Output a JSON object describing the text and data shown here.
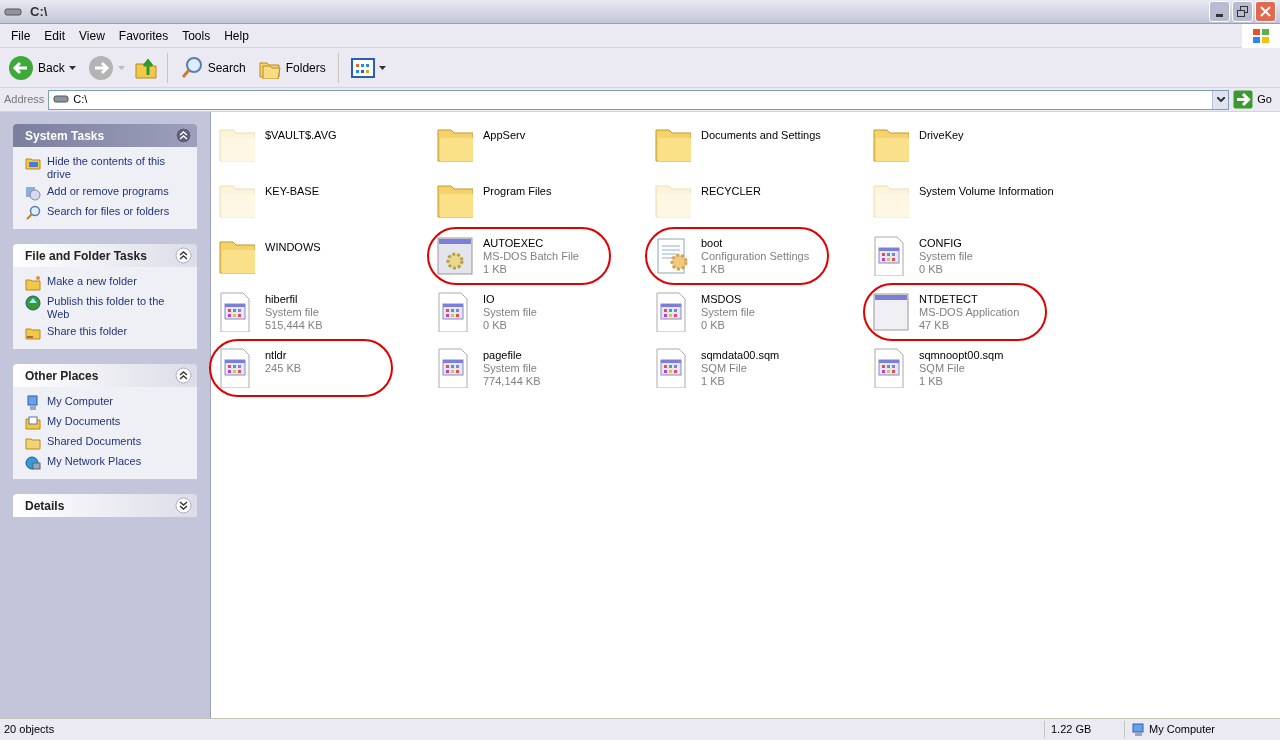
{
  "window": {
    "title": "C:\\"
  },
  "menu": [
    "File",
    "Edit",
    "View",
    "Favorites",
    "Tools",
    "Help"
  ],
  "toolbar": {
    "back": "Back",
    "search": "Search",
    "folders": "Folders"
  },
  "address": {
    "label": "Address",
    "value": "C:\\",
    "go": "Go"
  },
  "sidebar": [
    {
      "title": "System Tasks",
      "kind": "special",
      "expanded": true,
      "items": [
        {
          "label": "Hide the contents of this drive"
        },
        {
          "label": "Add or remove programs"
        },
        {
          "label": "Search for files or folders"
        }
      ]
    },
    {
      "title": "File and Folder Tasks",
      "kind": "normal",
      "expanded": true,
      "items": [
        {
          "label": "Make a new folder"
        },
        {
          "label": "Publish this folder to the Web"
        },
        {
          "label": "Share this folder"
        }
      ]
    },
    {
      "title": "Other Places",
      "kind": "normal",
      "expanded": true,
      "items": [
        {
          "label": "My Computer"
        },
        {
          "label": "My Documents"
        },
        {
          "label": "Shared Documents"
        },
        {
          "label": "My Network Places"
        }
      ]
    },
    {
      "title": "Details",
      "kind": "normal",
      "expanded": false
    }
  ],
  "files": [
    {
      "name": "$VAULT$.AVG",
      "kind": "folder",
      "hidden": true,
      "circled": false
    },
    {
      "name": "AppServ",
      "kind": "folder",
      "hidden": false,
      "circled": false
    },
    {
      "name": "Documents and Settings",
      "kind": "folder",
      "hidden": false,
      "circled": false
    },
    {
      "name": "DriveKey",
      "kind": "folder",
      "hidden": false,
      "circled": false
    },
    {
      "name": "KEY-BASE",
      "kind": "folder",
      "hidden": true,
      "circled": false
    },
    {
      "name": "Program Files",
      "kind": "folder",
      "hidden": false,
      "circled": false
    },
    {
      "name": "RECYCLER",
      "kind": "folder",
      "hidden": true,
      "circled": false
    },
    {
      "name": "System Volume Information",
      "kind": "folder",
      "hidden": true,
      "circled": false
    },
    {
      "name": "WINDOWS",
      "kind": "folder",
      "hidden": false,
      "circled": false
    },
    {
      "name": "AUTOEXEC",
      "kind": "batch",
      "type": "MS-DOS Batch File",
      "size": "1 KB",
      "circled": true
    },
    {
      "name": "boot",
      "kind": "config",
      "type": "Configuration Settings",
      "size": "1 KB",
      "circled": true
    },
    {
      "name": "CONFIG",
      "kind": "sysfile",
      "type": "System file",
      "size": "0 KB",
      "circled": false
    },
    {
      "name": "hiberfil",
      "kind": "sysfile",
      "type": "System file",
      "size": "515,444 KB",
      "circled": false
    },
    {
      "name": "IO",
      "kind": "sysfile",
      "type": "System file",
      "size": "0 KB",
      "circled": false
    },
    {
      "name": "MSDOS",
      "kind": "sysfile",
      "type": "System file",
      "size": "0 KB",
      "circled": false
    },
    {
      "name": "NTDETECT",
      "kind": "app",
      "type": "MS-DOS Application",
      "size": "47 KB",
      "circled": true
    },
    {
      "name": "ntldr",
      "kind": "sysfile",
      "size": "245 KB",
      "circled": true
    },
    {
      "name": "pagefile",
      "kind": "sysfile",
      "type": "System file",
      "size": "774,144 KB",
      "circled": false
    },
    {
      "name": "sqmdata00.sqm",
      "kind": "sysfile",
      "type": "SQM File",
      "size": "1 KB",
      "circled": false
    },
    {
      "name": "sqmnoopt00.sqm",
      "kind": "sysfile",
      "type": "SQM File",
      "size": "1 KB",
      "circled": false
    }
  ],
  "status_bar": {
    "objects": "20 objects",
    "size": "1.22 GB",
    "zone": "My Computer"
  }
}
